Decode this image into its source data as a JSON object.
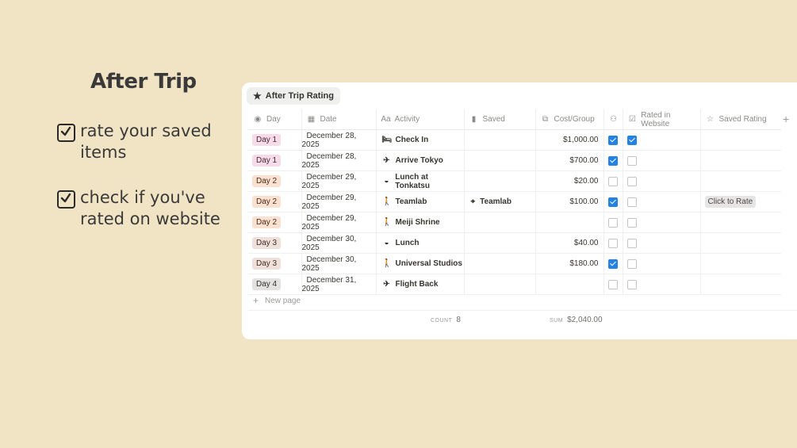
{
  "heading": "After Trip",
  "notes": [
    "rate your saved items",
    "check if you've rated on website"
  ],
  "view_tab": {
    "label": "After Trip Rating",
    "icon": "star-icon"
  },
  "columns": [
    {
      "label": "Day",
      "icon": "status-icon"
    },
    {
      "label": "Date",
      "icon": "calendar-icon"
    },
    {
      "label": "Activity",
      "icon": "text-icon"
    },
    {
      "label": "Saved",
      "icon": "bookmark-icon"
    },
    {
      "label": "Cost/Group",
      "icon": "formula-icon"
    },
    {
      "label": "",
      "icon": "people-icon"
    },
    {
      "label": "Rated in Website",
      "icon": "checkbox-icon"
    },
    {
      "label": "Saved Rating",
      "icon": "star-outline-icon"
    }
  ],
  "rows": [
    {
      "day": "Day 1",
      "day_color": "pink",
      "date": "December 28, 2025",
      "activity": "Check In",
      "activity_icon": "bed-icon",
      "saved": "",
      "cost": "$1,000.00",
      "check1": true,
      "check2": true,
      "rating": ""
    },
    {
      "day": "Day 1",
      "day_color": "pink",
      "date": "December 28, 2025",
      "activity": "Arrive Tokyo",
      "activity_icon": "plane-icon",
      "saved": "",
      "cost": "$700.00",
      "check1": true,
      "check2": false,
      "rating": ""
    },
    {
      "day": "Day 2",
      "day_color": "orange",
      "date": "December 29, 2025",
      "activity": "Lunch at Tonkatsu",
      "activity_icon": "bowl-icon",
      "saved": "",
      "cost": "$20.00",
      "check1": false,
      "check2": false,
      "rating": ""
    },
    {
      "day": "Day 2",
      "day_color": "orange",
      "date": "December 29, 2025",
      "activity": "Teamlab",
      "activity_icon": "walking-icon",
      "saved": "Teamlab",
      "cost": "$100.00",
      "check1": true,
      "check2": false,
      "rating": "Click to Rate"
    },
    {
      "day": "Day 2",
      "day_color": "orange",
      "date": "December 29, 2025",
      "activity": "Meiji Shrine",
      "activity_icon": "walking-icon",
      "saved": "",
      "cost": "",
      "check1": false,
      "check2": false,
      "rating": ""
    },
    {
      "day": "Day 3",
      "day_color": "brown",
      "date": "December 30, 2025",
      "activity": "Lunch",
      "activity_icon": "bowl-icon",
      "saved": "",
      "cost": "$40.00",
      "check1": false,
      "check2": false,
      "rating": ""
    },
    {
      "day": "Day 3",
      "day_color": "brown",
      "date": "December 30, 2025",
      "activity": "Universal Studios",
      "activity_icon": "walking-icon",
      "saved": "",
      "cost": "$180.00",
      "check1": true,
      "check2": false,
      "rating": ""
    },
    {
      "day": "Day 4",
      "day_color": "gray",
      "date": "December 31, 2025",
      "activity": "Flight Back",
      "activity_icon": "plane-icon",
      "saved": "",
      "cost": "",
      "check1": false,
      "check2": false,
      "rating": ""
    }
  ],
  "new_page": "New page",
  "footer": {
    "count_label": "COUNT",
    "count": "8",
    "sum_label": "SUM",
    "sum": "$2,040.00"
  }
}
